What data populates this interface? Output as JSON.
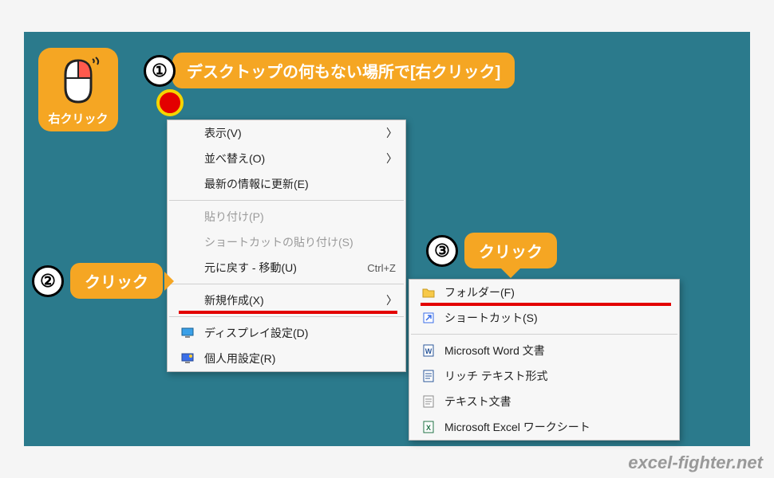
{
  "watermark": "excel-fighter.net",
  "mouse_badge": {
    "label": "右クリック"
  },
  "annotations": {
    "a1": {
      "num": "①",
      "text": "デスクトップの何もない場所で[右クリック]"
    },
    "a2": {
      "num": "②",
      "text": "クリック"
    },
    "a3": {
      "num": "③",
      "text": "クリック"
    }
  },
  "menu1": {
    "items": [
      {
        "label": "表示(V)",
        "has_sub": true
      },
      {
        "label": "並べ替え(O)",
        "has_sub": true
      },
      {
        "label": "最新の情報に更新(E)"
      }
    ],
    "items_b": [
      {
        "label": "貼り付け(P)",
        "disabled": true
      },
      {
        "label": "ショートカットの貼り付け(S)",
        "disabled": true
      },
      {
        "label": "元に戻す - 移動(U)",
        "shortcut": "Ctrl+Z"
      }
    ],
    "items_c": [
      {
        "label": "新規作成(X)",
        "has_sub": true,
        "highlight": true
      }
    ],
    "items_d": [
      {
        "label": "ディスプレイ設定(D)",
        "icon": "monitor"
      },
      {
        "label": "個人用設定(R)",
        "icon": "personalize"
      }
    ]
  },
  "menu2": {
    "items_a": [
      {
        "label": "フォルダー(F)",
        "icon": "folder",
        "highlight": true
      },
      {
        "label": "ショートカット(S)",
        "icon": "shortcut"
      }
    ],
    "items_b": [
      {
        "label": "Microsoft Word 文書",
        "icon": "word"
      },
      {
        "label": "リッチ テキスト形式",
        "icon": "rtf"
      },
      {
        "label": "テキスト文書",
        "icon": "text"
      },
      {
        "label": "Microsoft Excel ワークシート",
        "icon": "excel"
      }
    ]
  }
}
